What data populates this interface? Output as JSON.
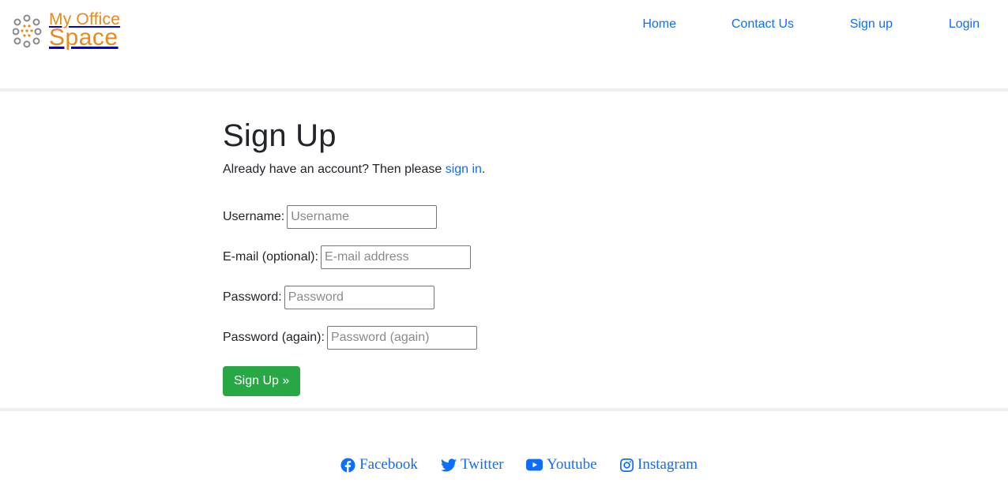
{
  "brand": {
    "line1": "My Office",
    "line2": "Space",
    "color": "#e8891c",
    "icon": "logo-dots-icon"
  },
  "nav": {
    "items": [
      {
        "label": "Home"
      },
      {
        "label": "Contact Us"
      },
      {
        "label": "Sign up"
      },
      {
        "label": "Login"
      }
    ]
  },
  "signup": {
    "title": "Sign Up",
    "intro_prefix": "Already have an account? Then please ",
    "intro_link": "sign in",
    "intro_suffix": ".",
    "fields": {
      "username": {
        "label": "Username:",
        "placeholder": "Username",
        "value": ""
      },
      "email": {
        "label": "E-mail (optional):",
        "placeholder": "E-mail address",
        "value": ""
      },
      "password": {
        "label": "Password:",
        "placeholder": "Password",
        "value": ""
      },
      "password2": {
        "label": "Password (again):",
        "placeholder": "Password (again)",
        "value": ""
      }
    },
    "submit_label": "Sign Up »",
    "submit_color": "#28a745"
  },
  "footer": {
    "links": [
      {
        "label": "Facebook",
        "icon": "facebook-icon"
      },
      {
        "label": "Twitter",
        "icon": "twitter-icon"
      },
      {
        "label": "Youtube",
        "icon": "youtube-icon"
      },
      {
        "label": "Instagram",
        "icon": "instagram-icon"
      }
    ],
    "link_color": "#0d6efd"
  }
}
